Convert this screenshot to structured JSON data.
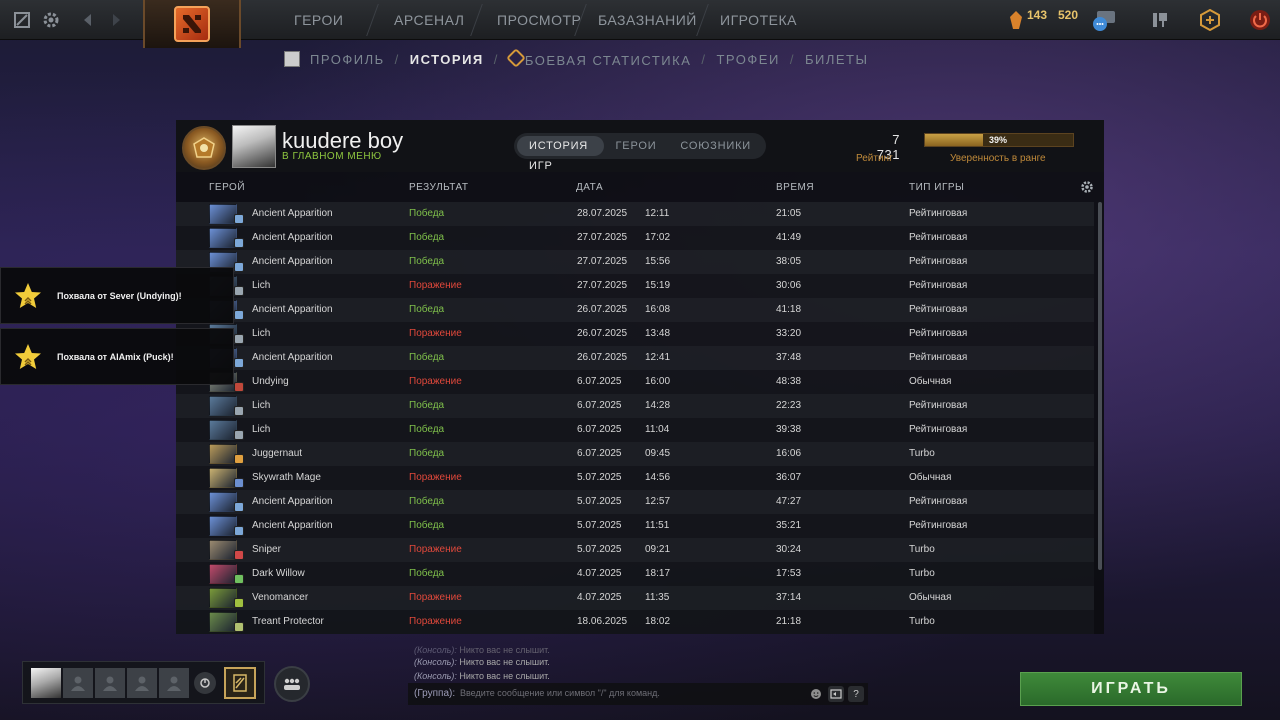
{
  "topbar": {
    "nav": [
      "ГЕРОИ",
      "АРСЕНАЛ",
      "ПРОСМОТР",
      "БАЗАЗНАНИЙ",
      "ИГРОТЕКА"
    ],
    "resources": [
      "143",
      "520"
    ],
    "icons": [
      "dota-plus-icon",
      "settings-icon",
      "back-icon",
      "dota-logo",
      "shards-icon",
      "chat-icon",
      "armory-icon",
      "plus-icon",
      "power-icon"
    ]
  },
  "subnav": {
    "profile": "ПРОФИЛЬ",
    "history": "ИСТОРИЯ",
    "stats": "БОЕВАЯ СТАТИСТИКА",
    "trophies": "ТРОФЕИ",
    "tickets": "БИЛЕТЫ",
    "sep": "/"
  },
  "player": {
    "name": "kuudere boy",
    "status": "В ГЛАВНОМ МЕНЮ",
    "rating": "7 731",
    "rating_label": "Рейтинг",
    "confidence_percent": 39,
    "confidence_text": "39%",
    "confidence_label": "Уверенность в ранге"
  },
  "tabs": [
    "ИСТОРИЯ ИГР",
    "ГЕРОИ",
    "СОЮЗНИКИ"
  ],
  "columns": {
    "hero": "ГЕРОЙ",
    "result": "РЕЗУЛЬТАТ",
    "date": "ДАТА",
    "duration": "ВРЕМЯ",
    "type": "ТИП ИГРЫ"
  },
  "matches": [
    {
      "hero": "Ancient Apparition",
      "result": "Победа",
      "win": true,
      "date": "28.07.2025",
      "time": "12:11",
      "duration": "21:05",
      "type": "Рейтинговая",
      "color": "#6b8fd4",
      "badge": "#7da8d8"
    },
    {
      "hero": "Ancient Apparition",
      "result": "Победа",
      "win": true,
      "date": "27.07.2025",
      "time": "17:02",
      "duration": "41:49",
      "type": "Рейтинговая",
      "color": "#6b8fd4",
      "badge": "#7da8d8"
    },
    {
      "hero": "Ancient Apparition",
      "result": "Победа",
      "win": true,
      "date": "27.07.2025",
      "time": "15:56",
      "duration": "38:05",
      "type": "Рейтинговая",
      "color": "#6b8fd4",
      "badge": "#7da8d8"
    },
    {
      "hero": "Lich",
      "result": "Поражение",
      "win": false,
      "date": "27.07.2025",
      "time": "15:19",
      "duration": "30:06",
      "type": "Рейтинговая",
      "color": "#5a7a9a",
      "badge": "#9aa6b0"
    },
    {
      "hero": "Ancient Apparition",
      "result": "Победа",
      "win": true,
      "date": "26.07.2025",
      "time": "16:08",
      "duration": "41:18",
      "type": "Рейтинговая",
      "color": "#6b8fd4",
      "badge": "#7da8d8"
    },
    {
      "hero": "Lich",
      "result": "Поражение",
      "win": false,
      "date": "26.07.2025",
      "time": "13:48",
      "duration": "33:20",
      "type": "Рейтинговая",
      "color": "#5a7a9a",
      "badge": "#9aa6b0"
    },
    {
      "hero": "Ancient Apparition",
      "result": "Победа",
      "win": true,
      "date": "26.07.2025",
      "time": "12:41",
      "duration": "37:48",
      "type": "Рейтинговая",
      "color": "#6b8fd4",
      "badge": "#7da8d8"
    },
    {
      "hero": "Undying",
      "result": "Поражение",
      "win": false,
      "date": "6.07.2025",
      "time": "16:00",
      "duration": "48:38",
      "type": "Обычная",
      "color": "#8a8f80",
      "badge": "#c0483b"
    },
    {
      "hero": "Lich",
      "result": "Победа",
      "win": true,
      "date": "6.07.2025",
      "time": "14:28",
      "duration": "22:23",
      "type": "Рейтинговая",
      "color": "#5a7a9a",
      "badge": "#9aa6b0"
    },
    {
      "hero": "Lich",
      "result": "Победа",
      "win": true,
      "date": "6.07.2025",
      "time": "11:04",
      "duration": "39:38",
      "type": "Рейтинговая",
      "color": "#5a7a9a",
      "badge": "#9aa6b0"
    },
    {
      "hero": "Juggernaut",
      "result": "Победа",
      "win": true,
      "date": "6.07.2025",
      "time": "09:45",
      "duration": "16:06",
      "type": "Turbo",
      "color": "#b89a5a",
      "badge": "#e0a040"
    },
    {
      "hero": "Skywrath Mage",
      "result": "Поражение",
      "win": false,
      "date": "5.07.2025",
      "time": "14:56",
      "duration": "36:07",
      "type": "Обычная",
      "color": "#c8b070",
      "badge": "#6c8fd0"
    },
    {
      "hero": "Ancient Apparition",
      "result": "Победа",
      "win": true,
      "date": "5.07.2025",
      "time": "12:57",
      "duration": "47:27",
      "type": "Рейтинговая",
      "color": "#6b8fd4",
      "badge": "#7da8d8"
    },
    {
      "hero": "Ancient Apparition",
      "result": "Победа",
      "win": true,
      "date": "5.07.2025",
      "time": "11:51",
      "duration": "35:21",
      "type": "Рейтинговая",
      "color": "#6b8fd4",
      "badge": "#7da8d8"
    },
    {
      "hero": "Sniper",
      "result": "Поражение",
      "win": false,
      "date": "5.07.2025",
      "time": "09:21",
      "duration": "30:24",
      "type": "Turbo",
      "color": "#9a8a70",
      "badge": "#d04848"
    },
    {
      "hero": "Dark Willow",
      "result": "Победа",
      "win": true,
      "date": "4.07.2025",
      "time": "18:17",
      "duration": "17:53",
      "type": "Turbo",
      "color": "#c04a6a",
      "badge": "#70c060"
    },
    {
      "hero": "Venomancer",
      "result": "Поражение",
      "win": false,
      "date": "4.07.2025",
      "time": "11:35",
      "duration": "37:14",
      "type": "Обычная",
      "color": "#7a9a3a",
      "badge": "#a0c040"
    },
    {
      "hero": "Treant Protector",
      "result": "Поражение",
      "win": false,
      "date": "18.06.2025",
      "time": "18:02",
      "duration": "21:18",
      "type": "Turbo",
      "color": "#6a8a4a",
      "badge": "#b0c070"
    }
  ],
  "notifications": [
    "Похвала от Sever (Undying)!",
    "Похвала от AlAmix (Puck)!"
  ],
  "chat": {
    "lines": [
      {
        "source": "(Консоль):",
        "text": "Никто вас не слышит."
      },
      {
        "source": "(Консоль):",
        "text": "Никто вас не слышит."
      },
      {
        "source": "(Консоль):",
        "text": "Никто вас не слышит."
      }
    ],
    "channel": "(Группа):",
    "placeholder": "Введите сообщение или символ \"/\" для команд.",
    "help": "?"
  },
  "play_button": "ИГРАТЬ",
  "colors": {
    "win": "#7fc04b",
    "loss": "#e0483b",
    "accent_gold": "#c08a3a",
    "play_green": "#3f8a3a"
  }
}
